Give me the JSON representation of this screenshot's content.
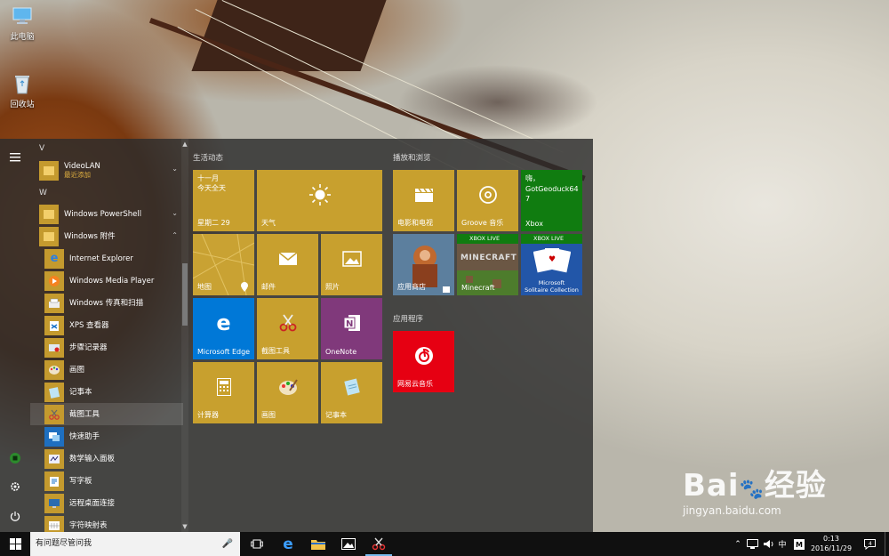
{
  "desktop": {
    "icons": [
      {
        "label": "此电脑",
        "icon": "computer-icon"
      },
      {
        "label": "回收站",
        "icon": "recycle-bin-icon"
      }
    ],
    "watermark": {
      "brand": "Bai",
      "brand2": "经验",
      "url": "jingyan.baidu.com"
    }
  },
  "start_menu": {
    "app_list": {
      "letter_v": "V",
      "letter_w": "W",
      "items": [
        {
          "label": "VideoLAN",
          "sub": "最近添加"
        },
        {
          "label": "Windows PowerShell"
        },
        {
          "label": "Windows 附件"
        },
        {
          "label": "Internet Explorer"
        },
        {
          "label": "Windows Media Player"
        },
        {
          "label": "Windows 传真和扫描"
        },
        {
          "label": "XPS 查看器"
        },
        {
          "label": "步骤记录器"
        },
        {
          "label": "画图"
        },
        {
          "label": "记事本"
        },
        {
          "label": "截图工具"
        },
        {
          "label": "快速助手"
        },
        {
          "label": "数学输入面板"
        },
        {
          "label": "写字板"
        },
        {
          "label": "远程桌面连接"
        },
        {
          "label": "字符映射表"
        }
      ]
    },
    "groups": {
      "life": "生活动态",
      "play": "播放和浏览",
      "apps": "应用程序"
    },
    "tiles": {
      "calendar": {
        "month": "十一月",
        "today": "今天全天",
        "date": "星期二 29"
      },
      "weather": "天气",
      "maps": "地图",
      "mail": "邮件",
      "photos": "照片",
      "edge": "Microsoft Edge",
      "snipping": "截图工具",
      "onenote": "OneNote",
      "calculator": "计算器",
      "paint": "画图",
      "notepad": "记事本",
      "movies": "电影和电视",
      "groove": "Groove 音乐",
      "xbox": {
        "greeting": "嗨，",
        "user": "GotGeoduck647",
        "label": "Xbox"
      },
      "store": "应用商店",
      "minecraft": {
        "badge": "XBOX LIVE",
        "label": "Minecraft",
        "art": "MINECRAFT"
      },
      "solitaire": {
        "badge": "XBOX LIVE",
        "label1": "Microsoft",
        "label2": "Solitaire Collection"
      },
      "netease": "网易云音乐"
    }
  },
  "taskbar": {
    "search_placeholder": "有问题尽管问我",
    "ime": "中",
    "ime_mode": "M",
    "time": "0:13",
    "date": "2016/11/29"
  },
  "colors": {
    "tile_gold": "#c8a02e",
    "edge_blue": "#0078d7",
    "onenote_purple": "#80397b",
    "xbox_green": "#107c10",
    "netease_red": "#e60012"
  }
}
